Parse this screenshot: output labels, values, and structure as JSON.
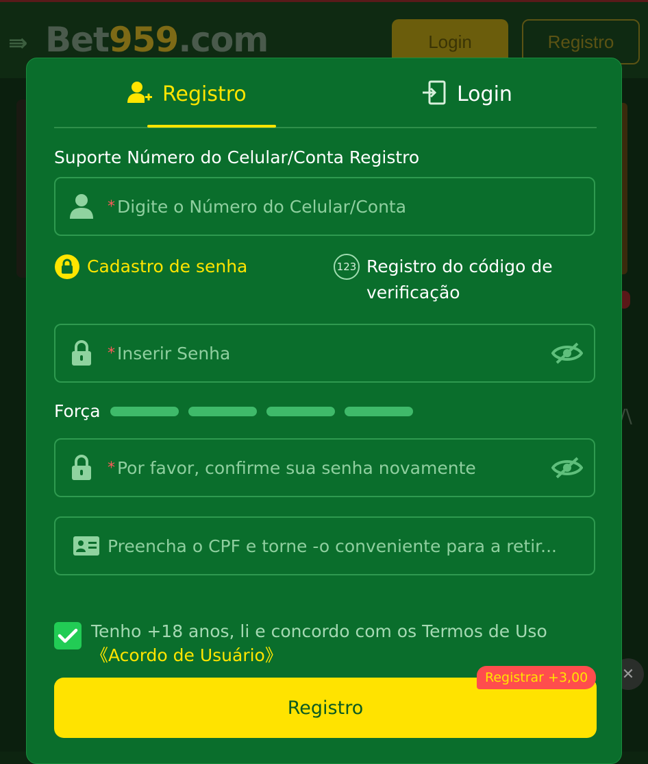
{
  "header": {
    "menu_glyph": "⇛",
    "logo_part1": "Bet",
    "logo_part2": "959",
    "logo_part3": ".com",
    "login_label": "Login",
    "register_label": "Registro"
  },
  "background": {
    "side_text": "/\\",
    "close_glyph": "✕"
  },
  "modal": {
    "tabs": [
      {
        "label": "Registro",
        "icon": "user-add-icon",
        "active": true
      },
      {
        "label": "Login",
        "icon": "login-door-icon",
        "active": false
      }
    ],
    "section_label": "Suporte Número do Celular/Conta Registro",
    "account_field": {
      "required_mark": "*",
      "placeholder": "Digite o Número do Celular/Conta"
    },
    "modes": {
      "password_label": "Cadastro de senha",
      "code_label": "Registro do código de verificação",
      "code_icon_text": "123"
    },
    "password_field": {
      "required_mark": "*",
      "placeholder": "Inserir Senha"
    },
    "strength": {
      "label": "Força",
      "bars": 4
    },
    "confirm_field": {
      "required_mark": "*",
      "placeholder": "Por favor, confirme sua senha novamente"
    },
    "cpf_field": {
      "placeholder": "Preencha o CPF e torne -o conveniente para a retir..."
    },
    "agree": {
      "checked": true,
      "text": "Tenho +18 anos, li e concordo com os Termos de Uso",
      "link": "《Acordo de Usuário》"
    },
    "submit_label": "Registro",
    "bonus_badge": "Registrar +3,00"
  },
  "colors": {
    "modal_bg": "#0a6e2c",
    "accent_yellow": "#ffe500",
    "checkbox_green": "#22cc55",
    "badge_red": "#ff4d4d"
  }
}
